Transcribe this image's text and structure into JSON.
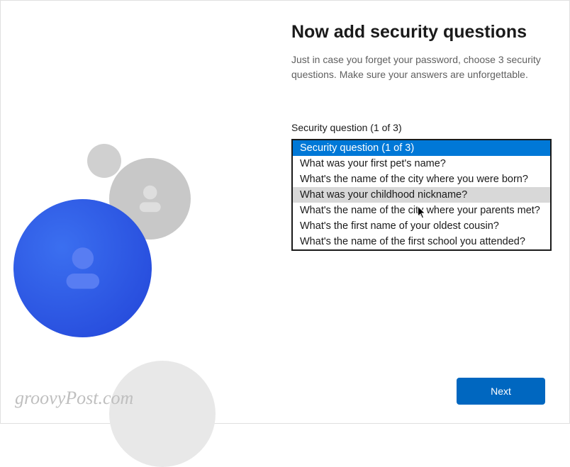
{
  "heading": "Now add security questions",
  "subheading": "Just in case you forget your password, choose 3 security questions. Make sure your answers are unforgettable.",
  "field_label": "Security question (1 of 3)",
  "dropdown": {
    "options": [
      "Security question (1 of 3)",
      "What was your first pet's name?",
      "What's the name of the city where you were born?",
      "What was your childhood nickname?",
      "What's the name of the city where your parents met?",
      "What's the first name of your oldest cousin?",
      "What's the name of the first school you attended?"
    ],
    "selected_index": 0,
    "hover_index": 3
  },
  "next_button": "Next",
  "watermark": "groovyPost.com"
}
